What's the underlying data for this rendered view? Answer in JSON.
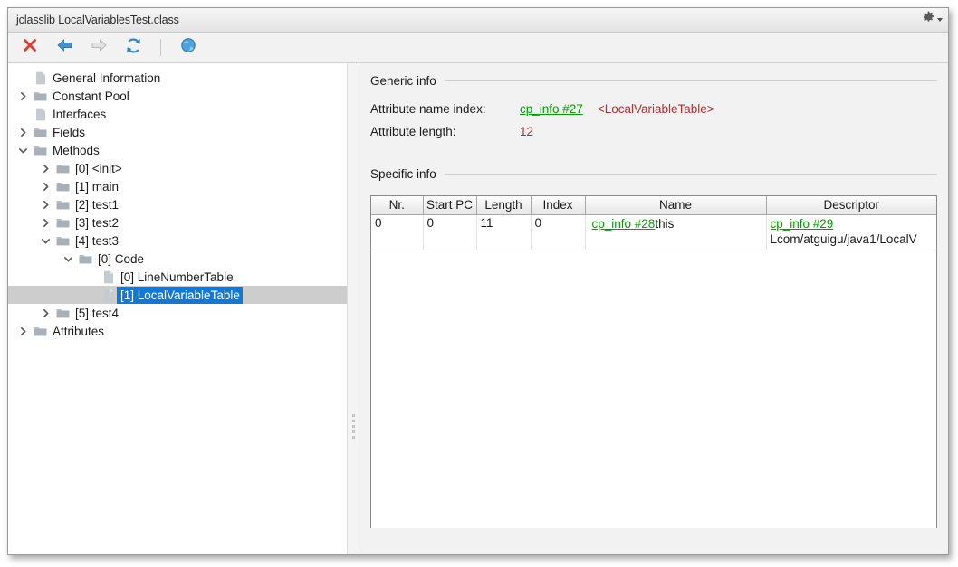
{
  "window": {
    "title": "jclasslib LocalVariablesTest.class",
    "gear_icon": "gear-icon",
    "caret_icon": "chevron-down-icon"
  },
  "toolbar": {
    "buttons": [
      {
        "name": "close-class-button",
        "icon": "close-x-icon",
        "tooltip": "Close"
      },
      {
        "name": "back-button",
        "icon": "arrow-left-icon",
        "tooltip": "Backward"
      },
      {
        "name": "forward-button",
        "icon": "arrow-right-icon",
        "tooltip": "Forward"
      },
      {
        "name": "reload-button",
        "icon": "refresh-icon",
        "tooltip": "Reload"
      },
      {
        "name": "browse-button",
        "icon": "globe-icon",
        "tooltip": "Browse classpath"
      }
    ]
  },
  "tree": {
    "nodes": [
      {
        "label": "General Information",
        "indent": 1,
        "twisty": "none",
        "icon": "file-icon",
        "selected": false
      },
      {
        "label": "Constant Pool",
        "indent": 1,
        "twisty": "collapsed",
        "icon": "folder-icon",
        "selected": false
      },
      {
        "label": "Interfaces",
        "indent": 1,
        "twisty": "none",
        "icon": "file-icon",
        "selected": false
      },
      {
        "label": "Fields",
        "indent": 1,
        "twisty": "collapsed",
        "icon": "folder-icon",
        "selected": false
      },
      {
        "label": "Methods",
        "indent": 1,
        "twisty": "expanded",
        "icon": "folder-icon",
        "selected": false
      },
      {
        "label": "[0] <init>",
        "indent": 2,
        "twisty": "collapsed",
        "icon": "folder-icon",
        "selected": false
      },
      {
        "label": "[1] main",
        "indent": 2,
        "twisty": "collapsed",
        "icon": "folder-icon",
        "selected": false
      },
      {
        "label": "[2] test1",
        "indent": 2,
        "twisty": "collapsed",
        "icon": "folder-icon",
        "selected": false
      },
      {
        "label": "[3] test2",
        "indent": 2,
        "twisty": "collapsed",
        "icon": "folder-icon",
        "selected": false
      },
      {
        "label": "[4] test3",
        "indent": 2,
        "twisty": "expanded",
        "icon": "folder-icon",
        "selected": false
      },
      {
        "label": "[0] Code",
        "indent": 3,
        "twisty": "expanded",
        "icon": "folder-icon",
        "selected": false
      },
      {
        "label": "[0] LineNumberTable",
        "indent": 4,
        "twisty": "none",
        "icon": "file-icon",
        "selected": false
      },
      {
        "label": "[1] LocalVariableTable",
        "indent": 4,
        "twisty": "none",
        "icon": "file-icon",
        "selected": true
      },
      {
        "label": "[5] test4",
        "indent": 2,
        "twisty": "collapsed",
        "icon": "folder-icon",
        "selected": false
      },
      {
        "label": "Attributes",
        "indent": 1,
        "twisty": "collapsed",
        "icon": "folder-icon",
        "selected": false
      }
    ]
  },
  "detail": {
    "generic": {
      "title": "Generic info",
      "rows": [
        {
          "label": "Attribute name index:",
          "link": "cp_info #27",
          "desc": "<LocalVariableTable>"
        },
        {
          "label": "Attribute length:",
          "value": "12"
        }
      ]
    },
    "specific": {
      "title": "Specific info",
      "columns": [
        "Nr.",
        "Start PC",
        "Length",
        "Index",
        "Name",
        "Descriptor"
      ],
      "rows": [
        {
          "nr": "0",
          "start_pc": "0",
          "length": "11",
          "index": "0",
          "name_link": "cp_info #28",
          "name_value": "this",
          "name_highlighted": true,
          "descriptor_link": "cp_info #29",
          "descriptor_value": "Lcom/atguigu/java1/LocalV"
        }
      ]
    }
  },
  "colors": {
    "link_green": "#00a000",
    "value_red": "#b03030",
    "highlight_pink": "#ff76b4",
    "selection_blue": "#1378d4",
    "selection_band": "#cdcdcd"
  }
}
